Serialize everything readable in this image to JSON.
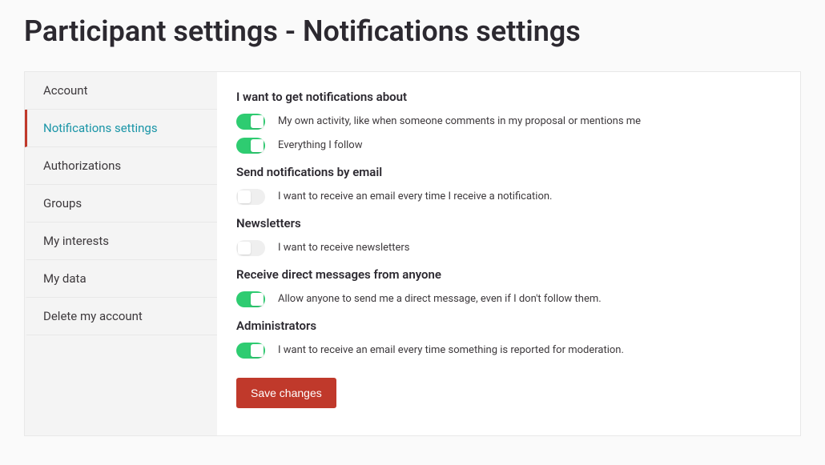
{
  "pageTitle": "Participant settings - Notifications settings",
  "sidebar": {
    "items": [
      {
        "label": "Account"
      },
      {
        "label": "Notifications settings"
      },
      {
        "label": "Authorizations"
      },
      {
        "label": "Groups"
      },
      {
        "label": "My interests"
      },
      {
        "label": "My data"
      },
      {
        "label": "Delete my account"
      }
    ],
    "activeIndex": 1
  },
  "sections": {
    "about": {
      "heading": "I want to get notifications about",
      "rows": [
        {
          "label": "My own activity, like when someone comments in my proposal or mentions me",
          "on": true
        },
        {
          "label": "Everything I follow",
          "on": true
        }
      ]
    },
    "email": {
      "heading": "Send notifications by email",
      "rows": [
        {
          "label": "I want to receive an email every time I receive a notification.",
          "on": false
        }
      ]
    },
    "newsletters": {
      "heading": "Newsletters",
      "rows": [
        {
          "label": "I want to receive newsletters",
          "on": false
        }
      ]
    },
    "dm": {
      "heading": "Receive direct messages from anyone",
      "rows": [
        {
          "label": "Allow anyone to send me a direct message, even if I don't follow them.",
          "on": true
        }
      ]
    },
    "admins": {
      "heading": "Administrators",
      "rows": [
        {
          "label": "I want to receive an email every time something is reported for moderation.",
          "on": true
        }
      ]
    }
  },
  "buttons": {
    "save": "Save changes"
  }
}
